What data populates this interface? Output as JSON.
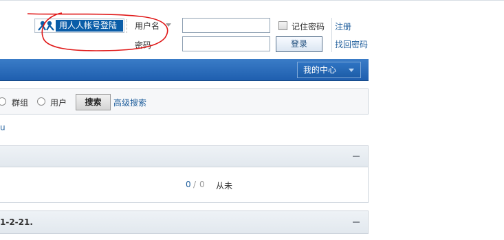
{
  "header": {
    "renren_button_label": "用人人帐号登陆",
    "username_label": "用户名",
    "password_label": "密码",
    "username_value": "",
    "password_value": "",
    "remember_label": "记住密码",
    "login_label": "登录",
    "register_label": "注册",
    "forgot_label": "找回密码"
  },
  "nav": {
    "my_center_label": "我的中心"
  },
  "search": {
    "options": [
      "群组",
      "用户"
    ],
    "search_button_label": "搜索",
    "advanced_label": "高级搜索"
  },
  "misc": {
    "partial_link_text": "u"
  },
  "forum_row": {
    "threads": "0",
    "separator": "/",
    "posts": "0",
    "last_post": "从未"
  },
  "section2": {
    "title": "1-2-21."
  },
  "colors": {
    "nav_blue": "#1f5faf",
    "link_blue": "#1f5e9c",
    "renren_blue": "#0a5da8"
  },
  "icons": [
    "renren-logo-icon",
    "chevron-down-icon",
    "collapse-icon"
  ]
}
